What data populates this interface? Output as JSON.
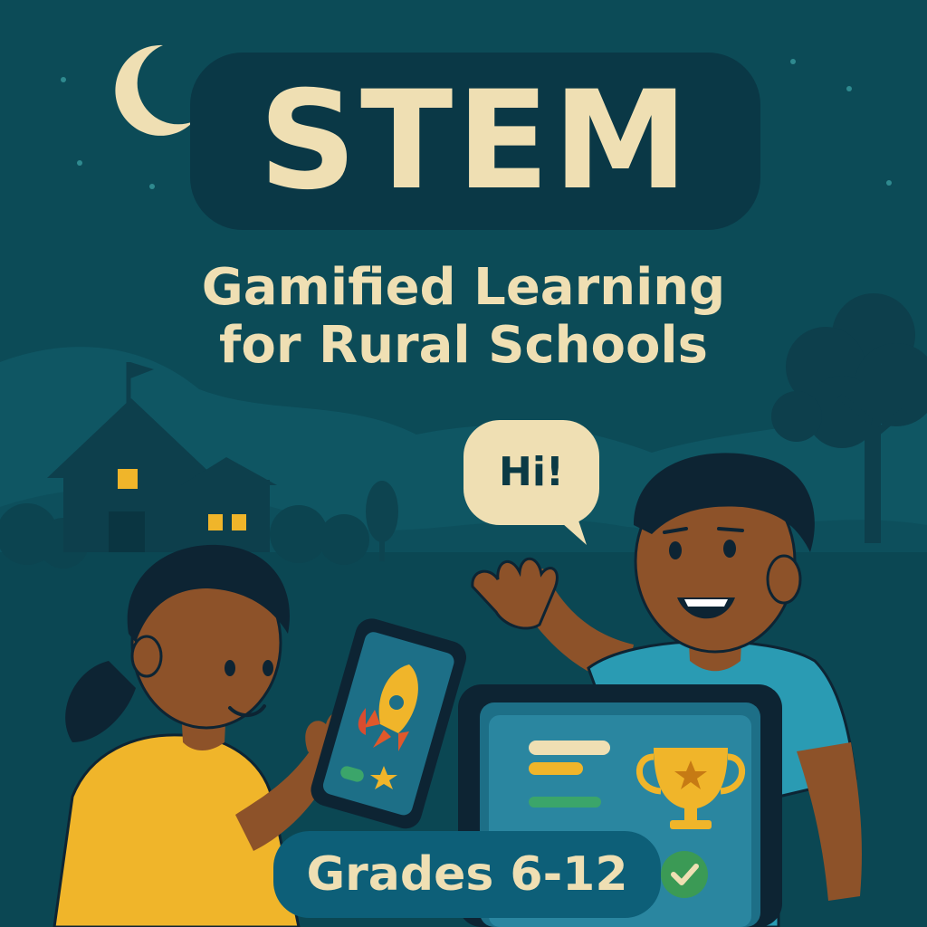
{
  "poster": {
    "title": "STEM",
    "subtitle_line1": "Gamified Learning",
    "subtitle_line2": "for Rural Schools",
    "speech_bubble": "Hi!",
    "grades": "Grades 6-12"
  },
  "colors": {
    "sky": "#0c4b57",
    "hills": "#0f5563",
    "title_pill": "#0a3846",
    "cream_text": "#efdfb3",
    "girl_shirt": "#f0b52a",
    "boy_shirt": "#2a9bb3",
    "skin": "#8d5229",
    "hair": "#0d2433",
    "screen": "#1d6f87",
    "trophy": "#f0b52a",
    "check_badge": "#3b9a55",
    "grades_pill": "#0d5f78"
  },
  "icons": [
    "moon-icon",
    "star-icon",
    "rocket-icon",
    "trophy-icon",
    "check-icon",
    "flag-icon",
    "house-icon",
    "tree-icon"
  ]
}
